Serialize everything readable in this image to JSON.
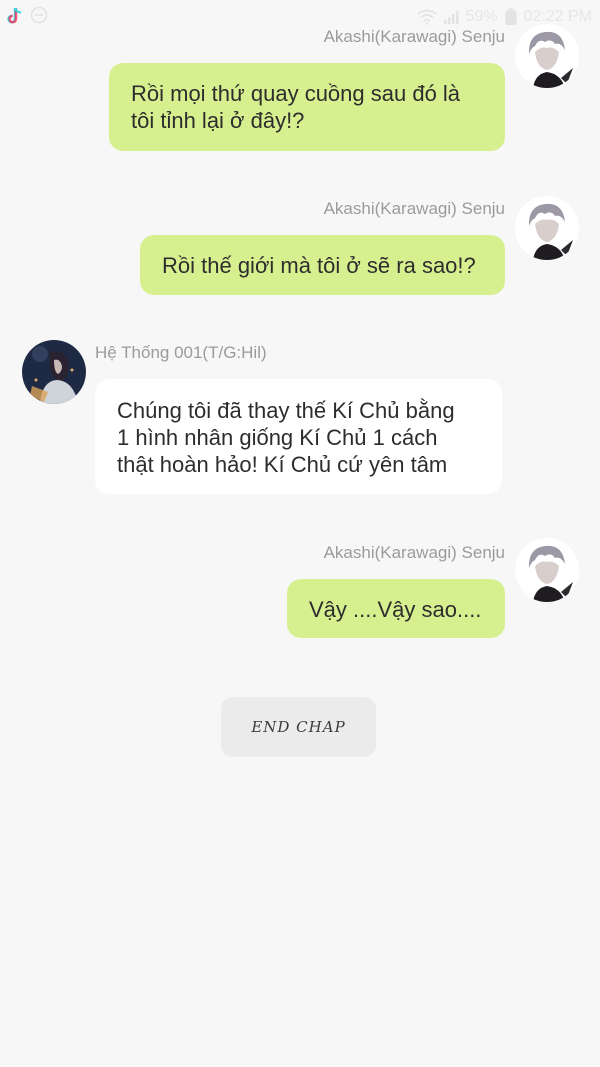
{
  "status_bar": {
    "icons": [
      "tiktok-icon",
      "minus-circle-icon",
      "wifi-icon",
      "signal-icon",
      "battery-icon"
    ],
    "battery": "59%",
    "time": "02:22 PM"
  },
  "messages": [
    {
      "side": "right",
      "sender": "Akashi(Karawagi) Senju",
      "text": "Rồi mọi thứ quay cuồng sau đó là\ntôi tỉnh lại ở đây!?"
    },
    {
      "side": "right",
      "sender": "Akashi(Karawagi) Senju",
      "text": "Rồi thế giới mà tôi ở sẽ ra sao!?"
    },
    {
      "side": "left",
      "sender": "Hệ Thống 001(T/G:Hil)",
      "text": "Chúng tôi đã thay thế Kí Chủ bằng\n1 hình nhân giống Kí Chủ 1 cách\nthật hoàn hảo! Kí Chủ cứ yên tâm"
    },
    {
      "side": "right",
      "sender": "Akashi(Karawagi) Senju",
      "text": "Vậy ....Vậy sao...."
    }
  ],
  "end_label": "END CHAP",
  "colors": {
    "background": "#f7f7f7",
    "my_bubble": "#d7f08f",
    "their_bubble": "#ffffff",
    "name_text": "#9b9b9b"
  }
}
